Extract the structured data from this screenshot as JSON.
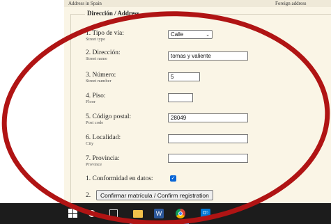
{
  "header": {
    "left_label": "Address in Spain",
    "right_label": "Foreign address"
  },
  "section": {
    "legend": "Dirección / Address"
  },
  "fields": [
    {
      "num": "1.",
      "label": "Tipo de vía:",
      "sub": "Street type",
      "value": "Calle"
    },
    {
      "num": "2.",
      "label": "Dirección:",
      "sub": "Street name",
      "value": "tomas y valiente"
    },
    {
      "num": "3.",
      "label": "Número:",
      "sub": "Street number",
      "value": "5"
    },
    {
      "num": "4.",
      "label": "Piso:",
      "sub": "Floor",
      "value": ""
    },
    {
      "num": "5.",
      "label": "Código postal:",
      "sub": "Post code",
      "value": "28049"
    },
    {
      "num": "6.",
      "label": "Localidad:",
      "sub": "City",
      "value": ""
    },
    {
      "num": "7.",
      "label": "Provincia:",
      "sub": "Province",
      "value": ""
    }
  ],
  "confirm": {
    "num": "1.",
    "label": "Conformidad en datos:",
    "checked": true,
    "check_glyph": "✓"
  },
  "submit": {
    "num": "2.",
    "label": "Confirmar matrícula / Confirm registration"
  },
  "taskbar": {
    "word_glyph": "W",
    "outlook_glyph": "O⁵",
    "icons": [
      "windows-start-icon",
      "search-icon",
      "task-view-icon",
      "file-explorer-icon",
      "word-icon",
      "chrome-icon",
      "outlook-icon"
    ]
  },
  "colors": {
    "annotation_ellipse": "#b01414",
    "form_background": "#faf5e6",
    "taskbar": "#1c1c1c",
    "checkbox": "#0a66d6"
  }
}
